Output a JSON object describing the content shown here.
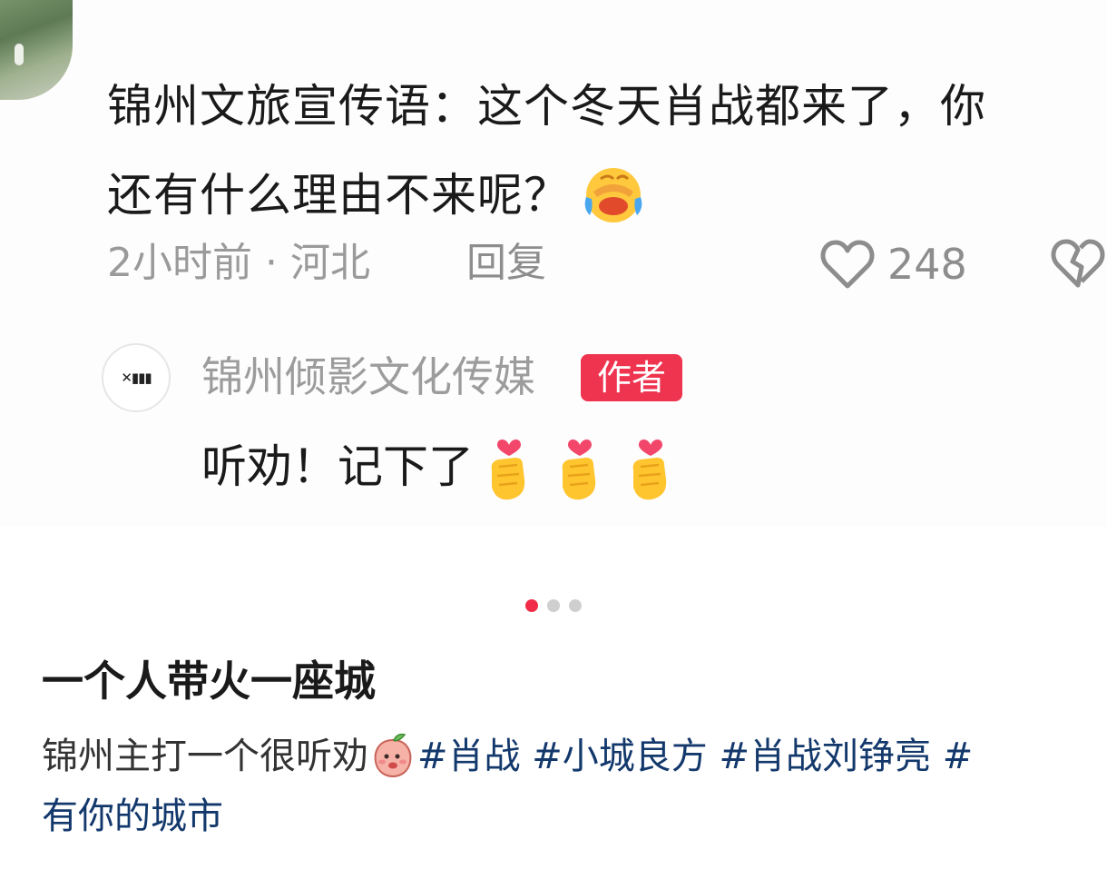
{
  "comment": {
    "text_line1": "锦州文旅宣传语：这个冬天肖战都来了，你",
    "text_line2": "还有什么理由不来呢？",
    "time_location": "2小时前 · 河北",
    "reply_label": "回复",
    "like_count": "248",
    "emoji": "laughing-crying-emoji"
  },
  "author_reply": {
    "name": "锦州倾影文化传媒",
    "badge": "作者",
    "text": "听劝！记下了",
    "emoji": "heart-hands-emoji",
    "emoji_count": 3
  },
  "carousel": {
    "total": 3,
    "active_index": 0,
    "active_color": "#f02c48"
  },
  "post": {
    "title": "一个人带火一座城",
    "desc_prefix": "锦州主打一个很听劝",
    "hashtags": [
      "#肖战",
      "#小城良方",
      "#肖战刘铮亮",
      "#",
      "有你的城市"
    ],
    "tag_color": "#13386c"
  }
}
